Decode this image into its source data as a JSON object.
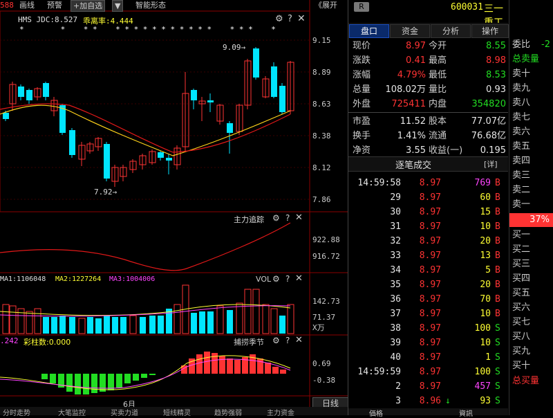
{
  "toolbar": {
    "left_fragment": "588",
    "items": [
      "画线",
      "预警",
      "+加自选",
      "▼",
      "智能形态"
    ],
    "collapse": "《展开"
  },
  "main_chart": {
    "indicator_left": "HMS JDC:8.527",
    "indicator_right": "乖离率:4.444",
    "price_ticks": [
      "9.15",
      "8.89",
      "8.63",
      "8.38",
      "8.12",
      "7.86"
    ],
    "high_label": "9.09→",
    "low_label": "7.92→",
    "stars": "*        *    * *    * * * * * * * * * * *    * * *    *"
  },
  "zhuli_panel": {
    "title": "主力追踪",
    "ticks": [
      "922.88",
      "916.72"
    ]
  },
  "vol_panel": {
    "ma_labels": [
      "MA1:1106048",
      "MA2:1227264",
      "MA3:1004006"
    ],
    "title": "VOL",
    "ticks": [
      "142.73",
      "71.37",
      "X万"
    ]
  },
  "season_panel": {
    "left_value": ".242",
    "caizhu_label": "彩柱数:0.000",
    "title": "捕捞季节",
    "ticks": [
      "0.69",
      "-0.38"
    ]
  },
  "month_label": "6月",
  "period_button": "日线",
  "bottom_tabs": [
    "分时走势",
    "大笔监控",
    "买卖力道",
    "短线精灵",
    "趋势强弱",
    "主力资金"
  ],
  "right_panel": {
    "badge": "R",
    "code": "600031",
    "name": "三一重工",
    "tabs": [
      "盘口",
      "资金",
      "分析",
      "操作"
    ],
    "quote": [
      {
        "l1": "现价",
        "v1": "8.97",
        "c1": "red",
        "l2": "今开",
        "v2": "8.55",
        "c2": "green"
      },
      {
        "l1": "涨跌",
        "v1": "0.41",
        "c1": "red",
        "l2": "最高",
        "v2": "8.98",
        "c2": "red"
      },
      {
        "l1": "涨幅",
        "v1": "4.79%",
        "c1": "red",
        "l2": "最低",
        "v2": "8.53",
        "c2": "green"
      },
      {
        "l1": "总量",
        "v1": "108.02万",
        "c1": "white",
        "l2": "量比",
        "v2": "0.93",
        "c2": "white"
      },
      {
        "l1": "外盘",
        "v1": "725411",
        "c1": "red",
        "l2": "内盘",
        "v2": "354820",
        "c2": "green"
      },
      {
        "l1": "市盈",
        "v1": "11.52",
        "c1": "white",
        "l2": "股本",
        "v2": "77.07亿",
        "c2": "white"
      },
      {
        "l1": "换手",
        "v1": "1.41%",
        "c1": "white",
        "l2": "流通",
        "v2": "76.68亿",
        "c2": "white"
      },
      {
        "l1": "净资",
        "v1": "3.55",
        "c1": "white",
        "l2": "收益(一)",
        "v2": "0.195",
        "c2": "white"
      }
    ],
    "ticks_title": "逐笔成交",
    "ticks_detail": "[详]",
    "trades": [
      {
        "t": "14:59:58",
        "p": "8.97",
        "q": "769",
        "s": "B",
        "qc": "mag",
        "sc": "red"
      },
      {
        "t": "29",
        "p": "8.97",
        "q": "60",
        "s": "B",
        "qc": "yellow",
        "sc": "red"
      },
      {
        "t": "30",
        "p": "8.97",
        "q": "15",
        "s": "B",
        "qc": "yellow",
        "sc": "red"
      },
      {
        "t": "31",
        "p": "8.97",
        "q": "10",
        "s": "B",
        "qc": "yellow",
        "sc": "red"
      },
      {
        "t": "32",
        "p": "8.97",
        "q": "20",
        "s": "B",
        "qc": "yellow",
        "sc": "red"
      },
      {
        "t": "33",
        "p": "8.97",
        "q": "13",
        "s": "B",
        "qc": "yellow",
        "sc": "red"
      },
      {
        "t": "34",
        "p": "8.97",
        "q": "5",
        "s": "B",
        "qc": "yellow",
        "sc": "red"
      },
      {
        "t": "35",
        "p": "8.97",
        "q": "20",
        "s": "B",
        "qc": "yellow",
        "sc": "red"
      },
      {
        "t": "36",
        "p": "8.97",
        "q": "70",
        "s": "B",
        "qc": "yellow",
        "sc": "red"
      },
      {
        "t": "37",
        "p": "8.97",
        "q": "10",
        "s": "B",
        "qc": "yellow",
        "sc": "red"
      },
      {
        "t": "38",
        "p": "8.97",
        "q": "100",
        "s": "S",
        "qc": "yellow",
        "sc": "green"
      },
      {
        "t": "39",
        "p": "8.97",
        "q": "10",
        "s": "S",
        "qc": "yellow",
        "sc": "green"
      },
      {
        "t": "40",
        "p": "8.97",
        "q": "1",
        "s": "S",
        "qc": "yellow",
        "sc": "green"
      },
      {
        "t": "14:59:59",
        "p": "8.97",
        "q": "100",
        "s": "S",
        "qc": "yellow",
        "sc": "green"
      },
      {
        "t": "2",
        "p": "8.97",
        "q": "457",
        "s": "S",
        "qc": "mag",
        "sc": "green"
      },
      {
        "t": "3",
        "p": "8.96",
        "q": "93",
        "s": "S",
        "qc": "yellow",
        "sc": "green",
        "arrow": "↓"
      }
    ],
    "bottom_tabs": [
      "価格",
      "資訊"
    ]
  },
  "order_book": {
    "weibi": "委比",
    "weibi_val": "-2",
    "total_sell": "总卖量",
    "sells": [
      "卖十",
      "卖九",
      "卖八",
      "卖七",
      "卖六",
      "卖五",
      "卖四",
      "卖三",
      "卖二",
      "卖一"
    ],
    "pct": "37%",
    "buys": [
      "买一",
      "买二",
      "买三",
      "买四",
      "买五",
      "买六",
      "买七",
      "买八",
      "买九",
      "买十"
    ],
    "total_buy": "总买量"
  },
  "colors": {
    "up": "#ff3333",
    "down": "#00e5ff",
    "ma_yellow": "#ffd21a",
    "ma_red": "#e01818",
    "panel_border": "#444"
  }
}
